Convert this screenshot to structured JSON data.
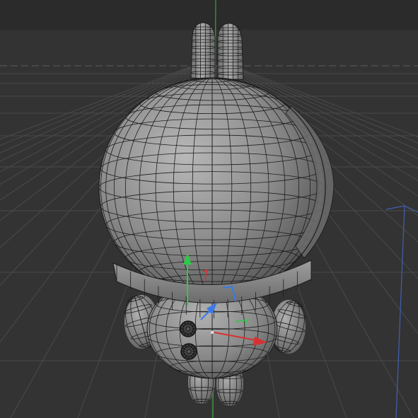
{
  "viewport": {
    "background_color": "#333333",
    "top_band_color": "#2b2b2b",
    "grid_color": "#4a4a4a",
    "horizon_color": "#5e5e5e",
    "world_y_axis_color": "#2fa82f",
    "world_x_axis_color": "#4060b0"
  },
  "model": {
    "mesh_color": "#8a8a8a",
    "wire_color": "#1a1a1a",
    "shading": "wireframe-on-shaded"
  },
  "gizmo": {
    "icon": "move-rotate-gizmo-icon",
    "x_axis_color": "#d63232",
    "y_axis_color": "#2ec94a",
    "z_axis_color": "#3a7ae8"
  }
}
